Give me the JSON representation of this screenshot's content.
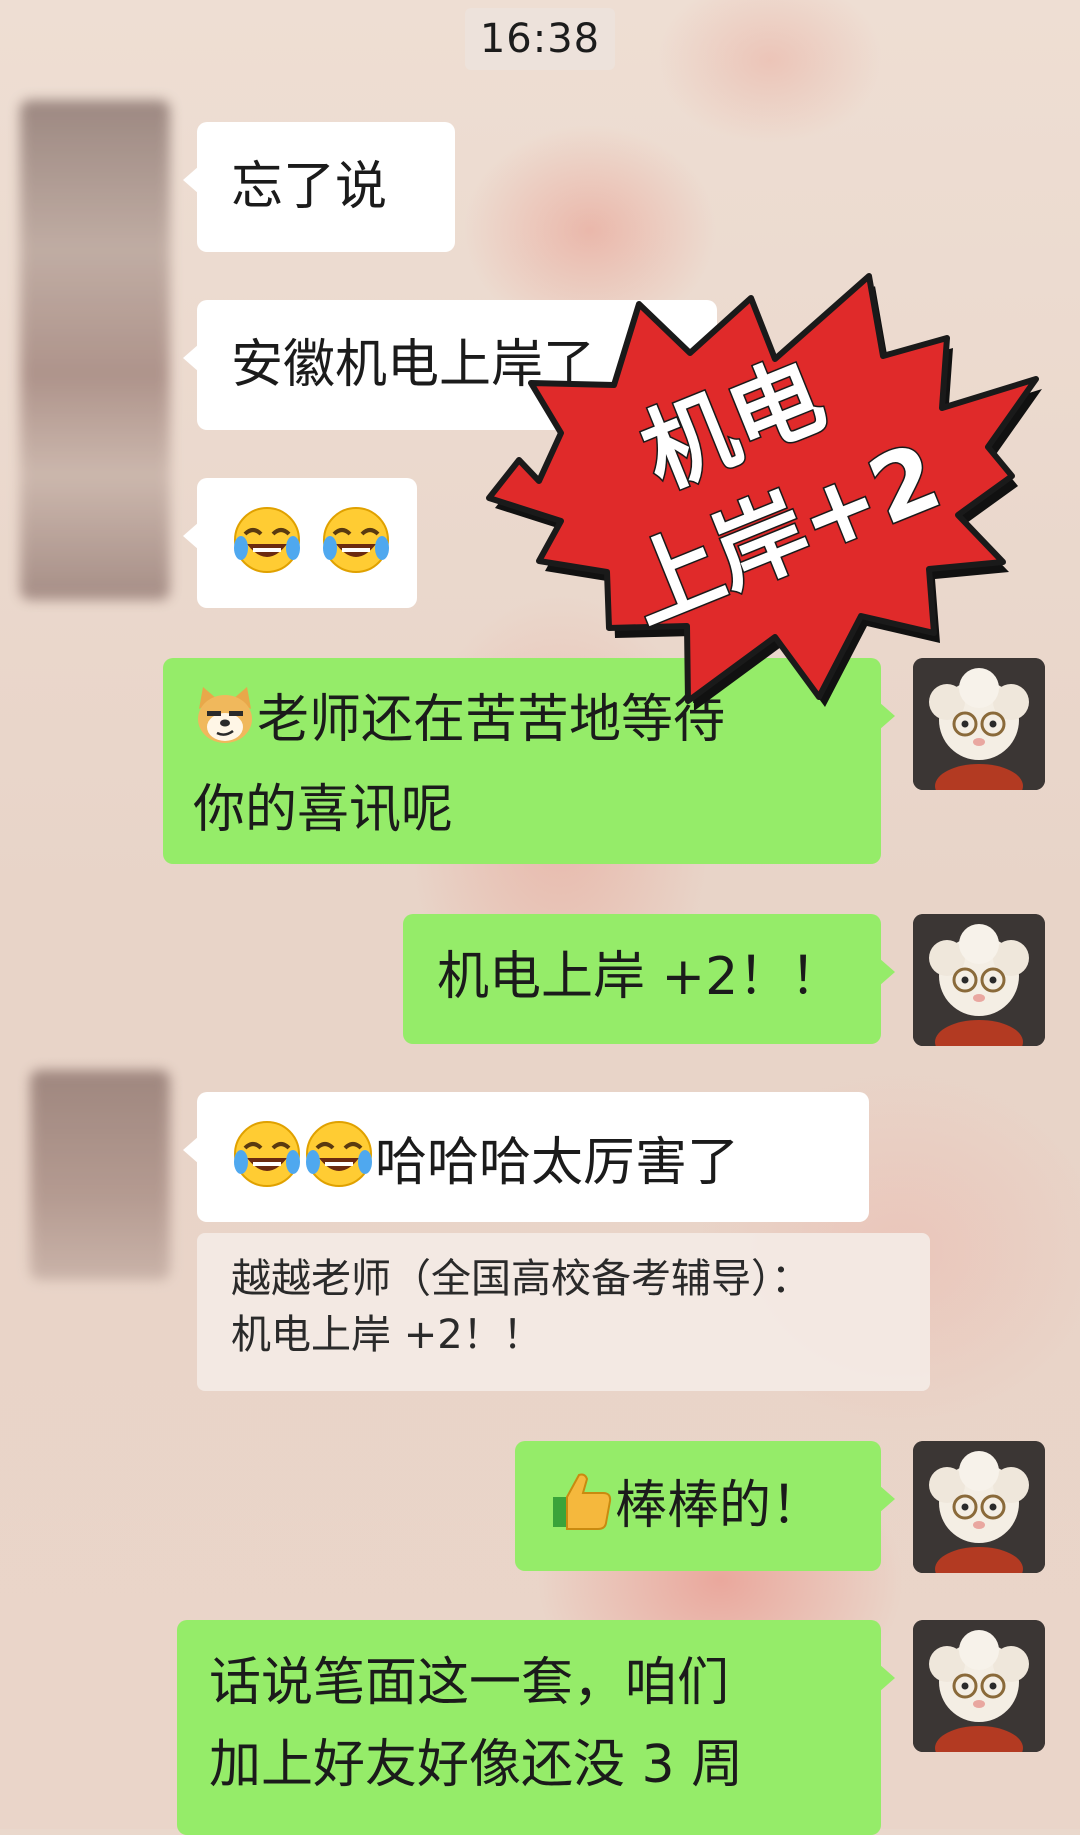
{
  "status": {
    "time": "16:38"
  },
  "messages": {
    "m1": "忘了说",
    "m2": "安徽机电上岸了",
    "m3_emoji": [
      "tears-of-joy-emoji",
      "tears-of-joy-emoji"
    ],
    "m4_text": "老师还在苦苦地等待",
    "m4_line2": "你的喜讯呢",
    "m4_emoji": "smirking-doge-emoji",
    "m5": "机电上岸 +2！！",
    "m6_text": "哈哈哈太厉害了",
    "m6_emoji": [
      "tears-of-joy-emoji",
      "tears-of-joy-emoji"
    ],
    "quote_line1": "越越老师（全国高校备考辅导）：",
    "quote_line2": "机电上岸 +2！！",
    "m7_text": "棒棒的！",
    "m7_emoji": "thumbs-up-emoji",
    "m8_line1": "话说笔面这一套，咱们",
    "m8_line2": "加上好友好像还没 3 周"
  },
  "overlay": {
    "line1": "机电",
    "line2": "上岸+2",
    "fill_color": "#e02a2a",
    "outline_color": "#1a1a1a",
    "shadow_color": "#111111"
  },
  "colors": {
    "self_bubble": "#95ec69",
    "other_bubble": "#ffffff"
  }
}
